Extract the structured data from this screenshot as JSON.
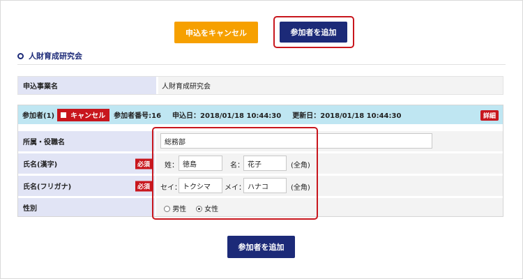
{
  "actions": {
    "cancel_application_label": "申込をキャンセル",
    "add_participant_label": "参加者を追加",
    "add_participant_bottom_label": "参加者を追加"
  },
  "section": {
    "title": "人財育成研究会"
  },
  "event": {
    "label": "申込事業名",
    "value": "人財育成研究会"
  },
  "participant": {
    "index_label": "参加者(1)",
    "cancel_chip_label": "キャンセル",
    "number_text": "参加者番号:16",
    "applied_text": "申込日：2018/01/18 10:44:30",
    "updated_text": "更新日：2018/01/18 10:44:30",
    "detail_label": "詳細",
    "fields": {
      "affiliation": {
        "label": "所属・役職名",
        "value": "総務部"
      },
      "name_kanji": {
        "label": "氏名(漢字)",
        "required_label": "必須",
        "last_label": "姓：",
        "last_value": "徳島",
        "first_label": "名：",
        "first_value": "花子",
        "note": "(全角)"
      },
      "name_kana": {
        "label": "氏名(フリガナ)",
        "required_label": "必須",
        "last_label": "セイ：",
        "last_value": "トクシマ",
        "first_label": "メイ：",
        "first_value": "ハナコ",
        "note": "(全角)"
      },
      "gender": {
        "label": "性別",
        "options": [
          "男性",
          "女性"
        ],
        "selected": "女性"
      }
    }
  },
  "colors": {
    "cancel_button": "#f6a000",
    "primary_button": "#1c2a78",
    "highlight": "#c8161d",
    "label_cell": "#e1e4f5",
    "participant_header": "#bfe6f2"
  }
}
